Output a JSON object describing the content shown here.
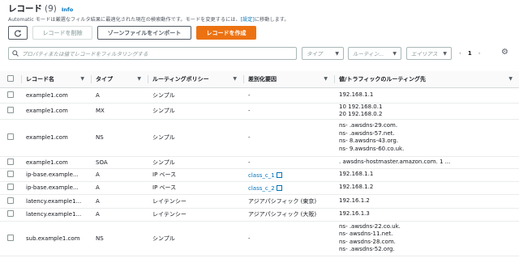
{
  "header": {
    "title": "レコード",
    "count": "(9)",
    "info": "Info",
    "description_before": "Automatic モードは厳選なフィルタ結果に最適化された現在の検索動作です。モードを変更するには、",
    "description_link": "[設定]",
    "description_after": "に移動します。"
  },
  "toolbar": {
    "refresh_icon": "refresh-icon",
    "delete_label": "レコードを削除",
    "import_label": "ゾーンファイルをインポート",
    "create_label": "レコードを作成"
  },
  "filters": {
    "search_placeholder": "プロパティまたは値でレコードをフィルタリングする",
    "type_placeholder": "タイプ",
    "routing_placeholder": "ルーティン...",
    "alias_placeholder": "エイリアス",
    "page": "1"
  },
  "columns": [
    "レコード名",
    "タイプ",
    "ルーティングポリシー",
    "差別化要因",
    "値/トラフィックのルーティング先"
  ],
  "rows": [
    {
      "name": "example1.com",
      "type": "A",
      "policy": "シンプル",
      "diff": "-",
      "values": [
        "192.168.1.1"
      ]
    },
    {
      "name": "example1.com",
      "type": "MX",
      "policy": "シンプル",
      "diff": "-",
      "values": [
        "10 192.168.0.1",
        "20 192.168.0.2"
      ]
    },
    {
      "name": "example1.com",
      "type": "NS",
      "policy": "シンプル",
      "diff": "-",
      "values": [
        "ns-       .awsdns-29.com.",
        "ns-       .awsdns-57.net.",
        "ns-       8.awsdns-43.org.",
        "ns-       9.awsdns-60.co.uk."
      ]
    },
    {
      "name": "example1.com",
      "type": "SOA",
      "policy": "シンプル",
      "diff": "-",
      "values": [
        "                          . awsdns-hostmaster.amazon.com. 1 ..."
      ]
    },
    {
      "name": "ip-base.example...",
      "type": "A",
      "policy": "IP ベース",
      "diff": "class_c_1",
      "diff_link": true,
      "values": [
        "192.168.1.1"
      ]
    },
    {
      "name": "ip-base.example...",
      "type": "A",
      "policy": "IP ベース",
      "diff": "class_c_2",
      "diff_link": true,
      "values": [
        "192.168.1.2"
      ]
    },
    {
      "name": "latency.example1...",
      "type": "A",
      "policy": "レイテンシー",
      "diff": "アジアパシフィック (東京)",
      "values": [
        "192.16.1.2"
      ]
    },
    {
      "name": "latency.example1...",
      "type": "A",
      "policy": "レイテンシー",
      "diff": "アジアパシフィック (大阪)",
      "values": [
        "192.16.1.3"
      ]
    },
    {
      "name": "sub.example1.com",
      "type": "NS",
      "policy": "シンプル",
      "diff": "-",
      "values": [
        "ns-        .awsdns-22.co.uk.",
        "ns-        awsdns-11.net.",
        "ns-        awsdns-28.com.",
        "ns-        .awsdns-52.org."
      ]
    }
  ],
  "colors": {
    "primary": "#ec7211",
    "link": "#0073bb",
    "text": "#16191f"
  }
}
